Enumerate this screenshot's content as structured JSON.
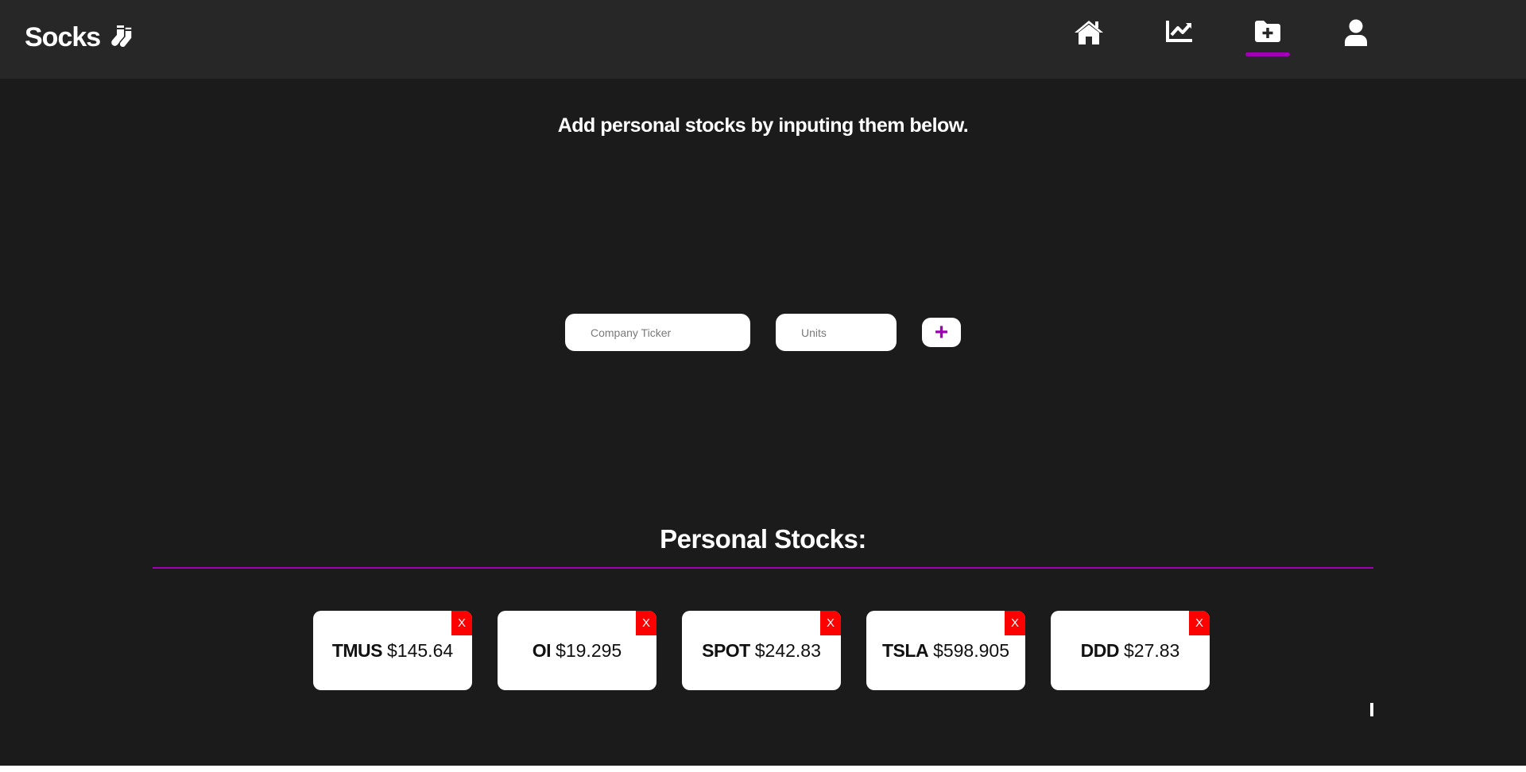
{
  "brand": {
    "name": "Socks",
    "icon": "socks-icon"
  },
  "nav": {
    "items": [
      {
        "name": "home",
        "icon": "home-icon",
        "active": false
      },
      {
        "name": "market-chart",
        "icon": "chart-line-icon",
        "active": false
      },
      {
        "name": "add-stocks",
        "icon": "folder-plus-icon",
        "active": true
      },
      {
        "name": "profile",
        "icon": "user-icon",
        "active": false
      }
    ],
    "accent_color": "#a000b4"
  },
  "intro_text": "Add personal stocks by inputing them below.",
  "form": {
    "ticker_placeholder": "Company Ticker",
    "units_placeholder": "Units",
    "ticker_value": "",
    "units_value": "",
    "add_label": "+"
  },
  "personal_stocks": {
    "title": "Personal Stocks:",
    "remove_label": "X",
    "items": [
      {
        "ticker": "TMUS",
        "price": "$145.64"
      },
      {
        "ticker": "OI",
        "price": "$19.295"
      },
      {
        "ticker": "SPOT",
        "price": "$242.83"
      },
      {
        "ticker": "TSLA",
        "price": "$598.905"
      },
      {
        "ticker": "DDD",
        "price": "$27.83"
      }
    ]
  },
  "colors": {
    "background": "#1b1b1b",
    "navbar": "#272727",
    "remove": "#ff0000"
  }
}
